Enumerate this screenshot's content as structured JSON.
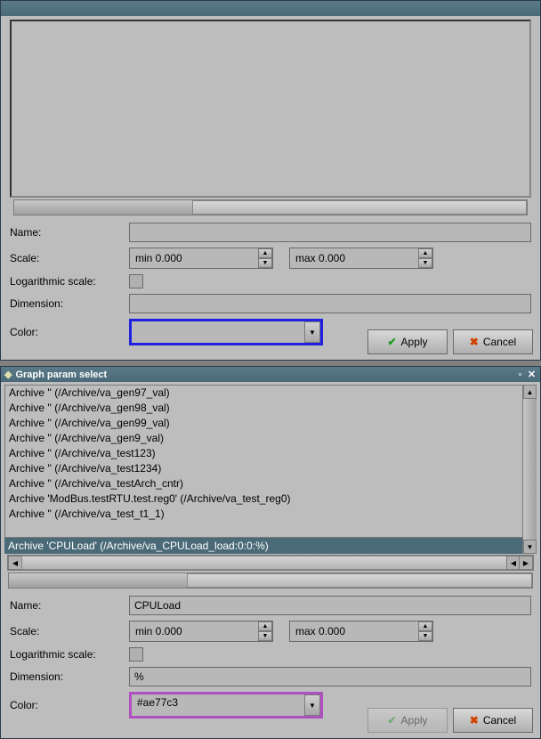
{
  "dlg1": {
    "form": {
      "name_lbl": "Name:",
      "name_val": "",
      "scale_lbl": "Scale:",
      "scale_min": "min 0.000",
      "scale_max": "max 0.000",
      "log_lbl": "Logarithmic scale:",
      "dim_lbl": "Dimension:",
      "dim_val": "",
      "color_lbl": "Color:",
      "color_val": ""
    },
    "apply": "Apply",
    "cancel": "Cancel"
  },
  "dlg2": {
    "title": "Graph param select",
    "list": [
      "Archive '' (/Archive/va_gen97_val)",
      "Archive '' (/Archive/va_gen98_val)",
      "Archive '' (/Archive/va_gen99_val)",
      "Archive '' (/Archive/va_gen9_val)",
      "Archive '' (/Archive/va_test123)",
      "Archive '' (/Archive/va_test1234)",
      "Archive '' (/Archive/va_testArch_cntr)",
      "Archive 'ModBus.testRTU.test.reg0' (/Archive/va_test_reg0)",
      "Archive '' (/Archive/va_test_t1_1)"
    ],
    "selected": "Archive 'CPULoad' (/Archive/va_CPULoad_load:0:0:%)",
    "form": {
      "name_lbl": "Name:",
      "name_val": "CPULoad",
      "scale_lbl": "Scale:",
      "scale_min": "min 0.000",
      "scale_max": "max 0.000",
      "log_lbl": "Logarithmic scale:",
      "dim_lbl": "Dimension:",
      "dim_val": "%",
      "color_lbl": "Color:",
      "color_val": "#ae77c3"
    },
    "apply": "Apply",
    "cancel": "Cancel"
  }
}
